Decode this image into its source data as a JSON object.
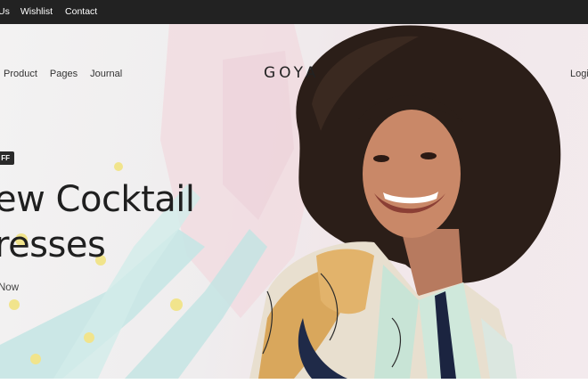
{
  "topbar": {
    "links": [
      "Us",
      "Wishlist",
      "Contact"
    ]
  },
  "header": {
    "nav": [
      "Product",
      "Pages",
      "Journal"
    ],
    "logo": "GOYA",
    "login": "Login"
  },
  "hero": {
    "badge": "FF",
    "headline_line1": "ew Cocktail",
    "headline_line2": "resses",
    "cta": "Now",
    "model_image": "woman-curly-hair-patterned-shirt"
  },
  "colors": {
    "topbar": "#222222",
    "pink_bg": "#f1e7ea",
    "teal_brush": "#bfe3e2",
    "yellow_dots": "#f1e48c"
  }
}
